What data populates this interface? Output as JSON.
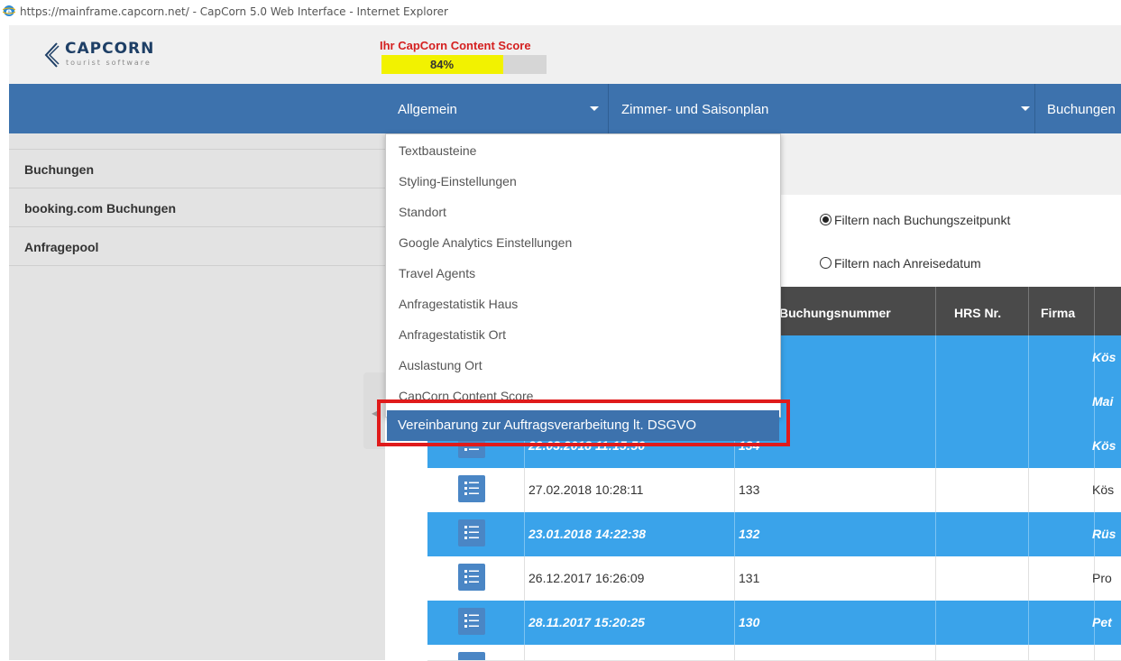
{
  "window": {
    "title": "https://mainframe.capcorn.net/ - CapCorn 5.0 Web Interface - Internet Explorer"
  },
  "brand": {
    "logo_text": "CAPCORN",
    "logo_sub": "tourist software"
  },
  "score": {
    "label": "Ihr CapCorn Content Score",
    "value": "84%",
    "percent": 84
  },
  "nav": {
    "tabs": [
      {
        "label": "Allgemein"
      },
      {
        "label": "Zimmer- und Saisonplan"
      },
      {
        "label": "Buchungen"
      }
    ]
  },
  "sidebar": {
    "items": [
      {
        "label": "Buchungen"
      },
      {
        "label": "booking.com Buchungen"
      },
      {
        "label": "Anfragepool"
      }
    ]
  },
  "filters": {
    "by_booking_time": "Filtern nach Buchungszeitpunkt",
    "by_arrival": "Filtern nach Anreisedatum",
    "selected": "by_booking_time"
  },
  "table": {
    "columns": [
      "Buchungsnummer",
      "HRS Nr.",
      "Firma"
    ],
    "rows": [
      {
        "date": "",
        "number": "",
        "name": "Kös",
        "highlighted": true
      },
      {
        "date": "",
        "number": "",
        "name": "Mai",
        "highlighted": true
      },
      {
        "date": "22.03.2018 11:15:56",
        "number": "134",
        "name": "Kös",
        "highlighted": true
      },
      {
        "date": "27.02.2018 10:28:11",
        "number": "133",
        "name": "Kös",
        "highlighted": false
      },
      {
        "date": "23.01.2018 14:22:38",
        "number": "132",
        "name": "Rüs",
        "highlighted": true
      },
      {
        "date": "26.12.2017 16:26:09",
        "number": "131",
        "name": "Pro",
        "highlighted": false
      },
      {
        "date": "28.11.2017 15:20:25",
        "number": "130",
        "name": "Pet",
        "highlighted": true
      },
      {
        "date": "",
        "number": "",
        "name": "",
        "highlighted": false
      }
    ]
  },
  "dropdown": {
    "items": [
      "Textbausteine",
      "Styling-Einstellungen",
      "Standort",
      "Google Analytics Einstellungen",
      "Travel Agents",
      "Anfragestatistik Haus",
      "Anfragestatistik Ort",
      "Auslastung Ort",
      "CapCorn Content Score"
    ],
    "highlighted_item": "Vereinbarung zur Auftragsverarbeitung lt. DSGVO"
  },
  "colors": {
    "nav": "#3d72ad",
    "row_highlight": "#3aa3ea",
    "annotation": "#e01b1b",
    "score_fill": "#f2f200"
  }
}
